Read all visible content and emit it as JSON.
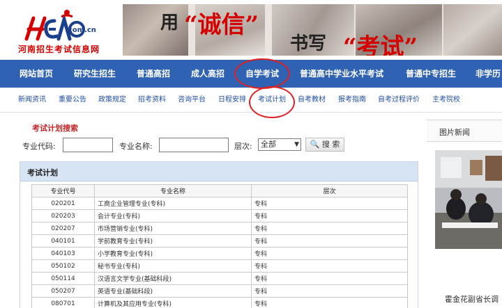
{
  "header": {
    "logo_domain": ".com.cn",
    "logo_name": "河南招生考试信息网",
    "slogan": {
      "part1": "用",
      "part2": "“诚信”",
      "part3": "书写",
      "part4": "“考试”"
    }
  },
  "main_nav": {
    "items": [
      "网站首页",
      "研究生招生",
      "普通高招",
      "成人高招",
      "自学考试",
      "普通高中学业水平考试",
      "普通中专招生",
      "非学历"
    ]
  },
  "sub_nav": {
    "items": [
      "新闻资讯",
      "重要公告",
      "政策规定",
      "招考资料",
      "咨询平台",
      "日程安排",
      "考试计划",
      "自考教材",
      "报考指南",
      "自考过程评价",
      "主考院校"
    ]
  },
  "search": {
    "title": "考试计划搜索",
    "code_label": "专业代码:",
    "code_value": "",
    "name_label": "专业名称:",
    "name_value": "",
    "level_label": "层次:",
    "level_selected": "全部",
    "button": "搜 索"
  },
  "plan": {
    "title": "考试计划",
    "columns": [
      "专业代号",
      "专业名称",
      "层次"
    ],
    "rows": [
      [
        "020201",
        "工商企业管理专业(专科)",
        "专科"
      ],
      [
        "020203",
        "会计专业(专科)",
        "专科"
      ],
      [
        "020207",
        "市场营销专业(专科)",
        "专科"
      ],
      [
        "040101",
        "学前教育专业(专科)",
        "专科"
      ],
      [
        "040103",
        "小学教育专业(专科)",
        "专科"
      ],
      [
        "050102",
        "秘书专业(专科)",
        "专科"
      ],
      [
        "050114",
        "汉语言文学专业(基础科段)",
        "专科"
      ],
      [
        "050207",
        "英语专业(基础科段)",
        "专科"
      ],
      [
        "080701",
        "计算机及其应用专业(专科)",
        "专科"
      ]
    ]
  },
  "sidebar": {
    "title": "图片新闻",
    "caption": "霍金花副省长调"
  },
  "colors": {
    "nav_blue": "#2f62b2",
    "link_blue": "#1f4ea3",
    "highlight_red": "#e02020"
  }
}
